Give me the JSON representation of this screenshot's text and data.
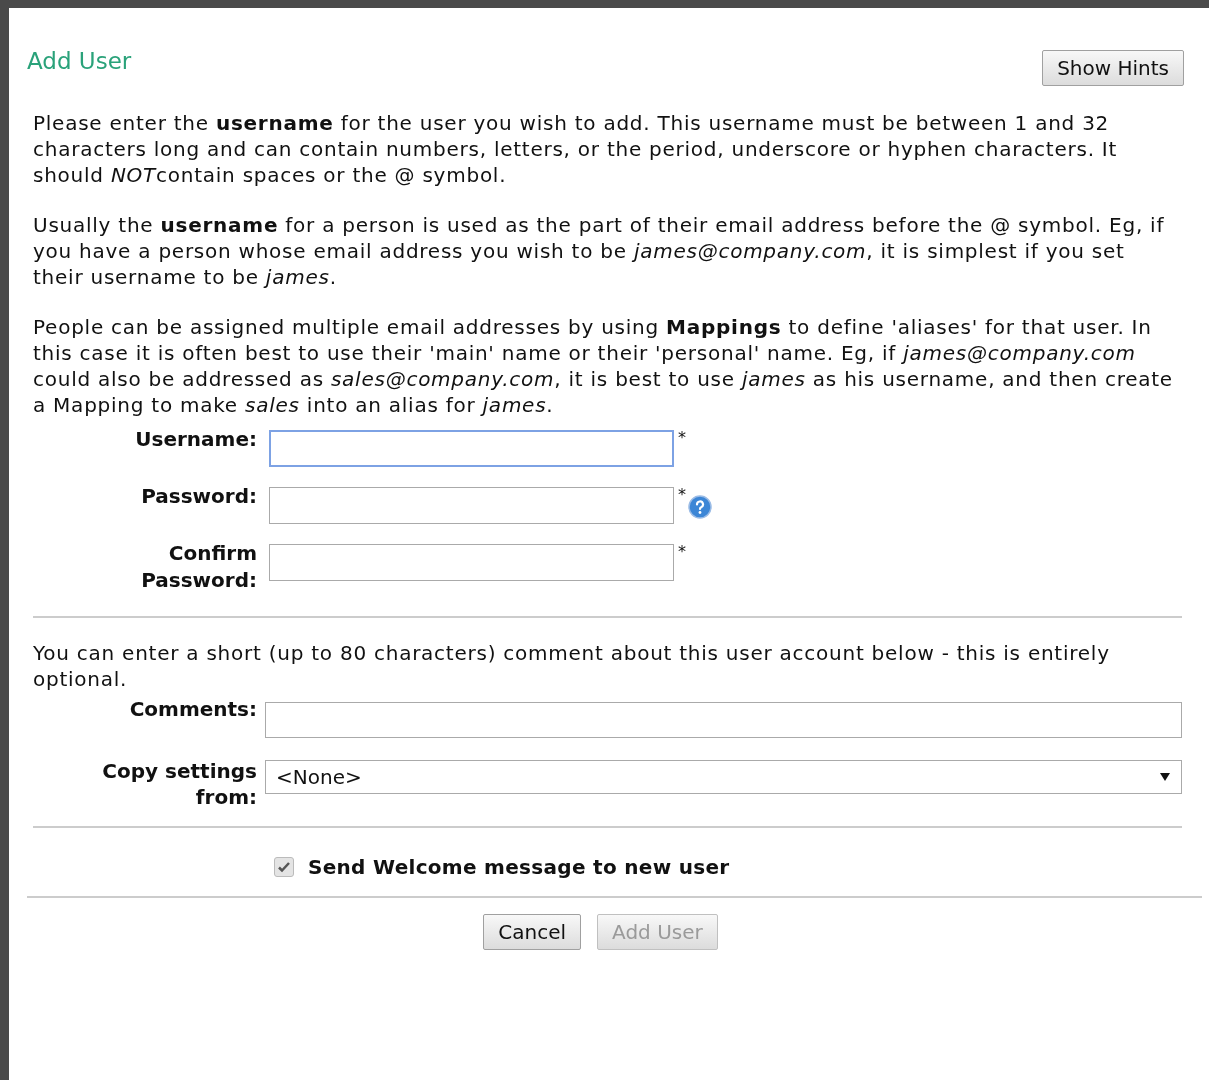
{
  "title": "Add User",
  "hints_button": {
    "label": "Show Hints"
  },
  "paragraphs": [
    [
      {
        "kind": "plain",
        "text": "Please enter the "
      },
      {
        "kind": "bold",
        "text": "username"
      },
      {
        "kind": "plain",
        "text": " for the user you wish to add. This username must be between 1 and 32 characters long and can contain numbers, letters, or the period, underscore or hyphen characters. It should "
      },
      {
        "kind": "italic",
        "text": "NOT"
      },
      {
        "kind": "plain",
        "text": "contain spaces or the @ symbol."
      }
    ],
    [
      {
        "kind": "plain",
        "text": "Usually the "
      },
      {
        "kind": "bold",
        "text": "username"
      },
      {
        "kind": "plain",
        "text": " for a person is used as the part of their email address before the @ symbol. Eg, if you have a person whose email address you wish to be "
      },
      {
        "kind": "italic",
        "text": "james@company.com"
      },
      {
        "kind": "plain",
        "text": ", it is simplest if you set their username to be "
      },
      {
        "kind": "italic",
        "text": "james"
      },
      {
        "kind": "plain",
        "text": "."
      }
    ],
    [
      {
        "kind": "plain",
        "text": "People can be assigned multiple email addresses by using "
      },
      {
        "kind": "bold",
        "text": "Mappings"
      },
      {
        "kind": "plain",
        "text": " to define 'aliases' for that user. In this case it is often best to use their 'main' name or their 'personal' name. Eg, if "
      },
      {
        "kind": "italic",
        "text": "james@company.com"
      },
      {
        "kind": "plain",
        "text": " could also be addressed as "
      },
      {
        "kind": "italic",
        "text": "sales@company.com"
      },
      {
        "kind": "plain",
        "text": ", it is best to use "
      },
      {
        "kind": "italic",
        "text": "james"
      },
      {
        "kind": "plain",
        "text": " as his username, and then create a Mapping to make "
      },
      {
        "kind": "italic",
        "text": "sales"
      },
      {
        "kind": "plain",
        "text": " into an alias for "
      },
      {
        "kind": "italic",
        "text": "james"
      },
      {
        "kind": "plain",
        "text": "."
      }
    ]
  ],
  "credential_fields": [
    {
      "label": "Username:",
      "required_mark": "*",
      "help": false,
      "focused": true
    },
    {
      "label": "Password:",
      "required_mark": "*",
      "help": true,
      "focused": false
    },
    {
      "label": "Confirm Password:",
      "required_mark": "*",
      "help": false,
      "focused": false
    }
  ],
  "comment_intro": "You can enter a short (up to 80 characters) comment about this user account below - this is entirely optional.",
  "comments": {
    "label": "Comments:"
  },
  "copy_settings": {
    "label": "Copy settings from:",
    "value": "<None>"
  },
  "welcome": {
    "label": "Send Welcome message to new user",
    "checked": true
  },
  "buttons": [
    {
      "label": "Cancel",
      "disabled": false
    },
    {
      "label": "Add User",
      "disabled": true
    }
  ]
}
